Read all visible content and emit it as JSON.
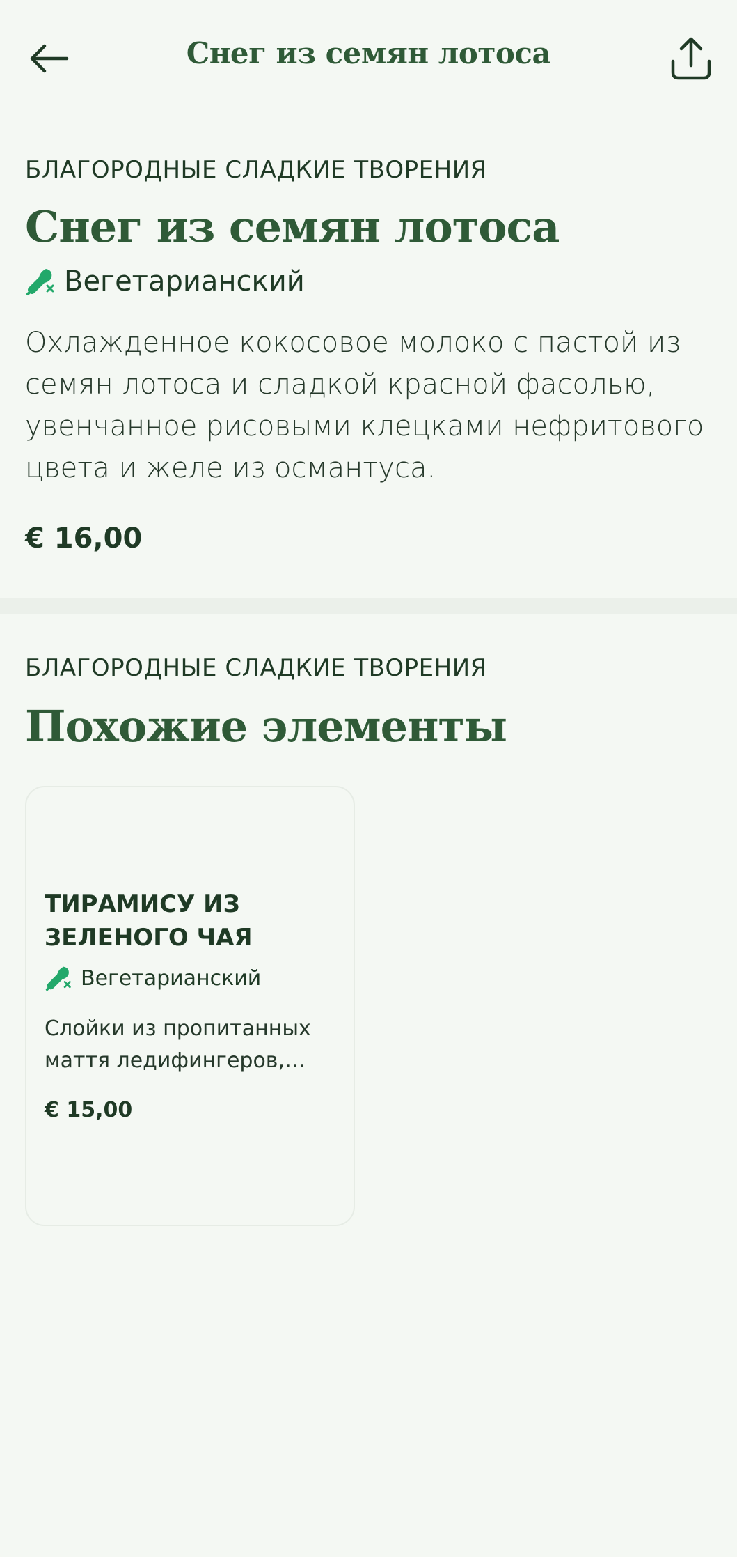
{
  "header": {
    "title": "Снег из семян лотоса",
    "back_icon": "arrow-left-icon",
    "share_icon": "share-icon"
  },
  "item": {
    "category": "БЛАГОРОДНЫЕ СЛАДКИЕ ТВОРЕНИЯ",
    "title": "Снег из семян лотоса",
    "dietary_label": "Вегетарианский",
    "dietary_icon": "vegetarian-icon",
    "description": "Охлажденное кокосовое молоко с пастой из семян лотоса и сладкой красной фасолью, увенчанное рисовыми клецками нефритового цвета и желе из османтуса.",
    "price": "€ 16,00"
  },
  "similar": {
    "category": "БЛАГОРОДНЫЕ СЛАДКИЕ ТВОРЕНИЯ",
    "title": "Похожие элементы",
    "items": [
      {
        "title": "ТИРАМИСУ ИЗ ЗЕЛЕНОГО ЧАЯ",
        "dietary_label": "Вегетарианский",
        "description": "Слойки из пропитанных маття ледифингеров, кре...",
        "price": "€ 15,00"
      }
    ]
  },
  "colors": {
    "background": "#f4f8f3",
    "accent_green": "#2f5a37",
    "text_dark": "#1f3a25",
    "veg_icon": "#22a86a"
  }
}
